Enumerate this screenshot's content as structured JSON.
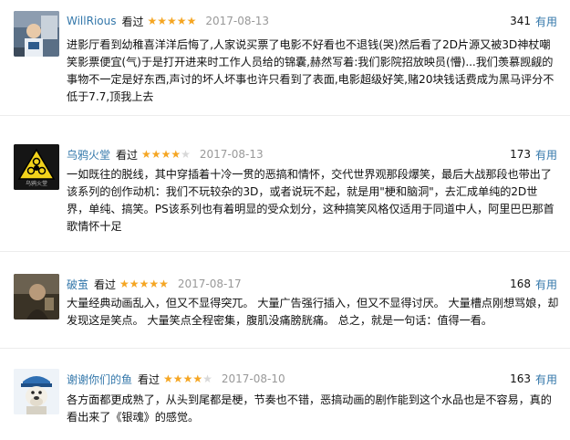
{
  "reviews": [
    {
      "username": "WillRious",
      "watched": "看过",
      "rating": 5,
      "date": "2017-08-13",
      "votes": "341",
      "useful": "有用",
      "text": "进影厅看到幼稚喜洋洋后悔了,人家说买票了电影不好看也不退钱(哭)然后看了2D片源又被3D神杖嘲笑影票便宜(气)于是打开进来时工作人员给的锦囊,赫然写着:我们影院招放映员(懵)...我们羡慕觊觎的事物不一定是好东西,声讨的坏人坏事也许只看到了表面,电影超级好笑,赌20块钱话费成为黑马评分不低于7.7,顶我上去"
    },
    {
      "username": "乌鸦火堂",
      "watched": "看过",
      "rating": 4,
      "date": "2017-08-13",
      "votes": "173",
      "useful": "有用",
      "avatar_caption": "乌鸦火堂",
      "text": "一如既往的脱线，其中穿插着十冷一贯的恶搞和情怀，交代世界观那段爆笑，最后大战那段也带出了该系列的创作动机：我们不玩较杂的3D，或者说玩不起，就是用\"梗和脑洞\"，去汇成单纯的2D世界，单纯、搞笑。PS该系列也有着明显的受众划分，这种搞笑风格仅适用于同道中人，阿里巴巴那首歌情怀十足"
    },
    {
      "username": "破茧",
      "watched": "看过",
      "rating": 5,
      "date": "2017-08-17",
      "votes": "168",
      "useful": "有用",
      "text": "大量经典动画乱入，但又不显得突兀。 大量广告强行插入，但又不显得讨厌。 大量槽点刚想骂娘，却发现这是笑点。 大量笑点全程密集，腹肌没痛膀胱痛。 总之，就是一句话：值得一看。"
    },
    {
      "username": "谢谢你们的鱼",
      "watched": "看过",
      "rating": 4,
      "date": "2017-08-10",
      "votes": "163",
      "useful": "有用",
      "text": "各方面都更成熟了，从头到尾都是梗，节奏也不错，恶搞动画的剧作能到这个水品也是不容易，真的看出来了《银魂》的感觉。"
    }
  ],
  "colors": {
    "link": "#3377aa",
    "star_on": "#f5a623",
    "star_off": "#d8d8d8",
    "date": "#999999"
  }
}
